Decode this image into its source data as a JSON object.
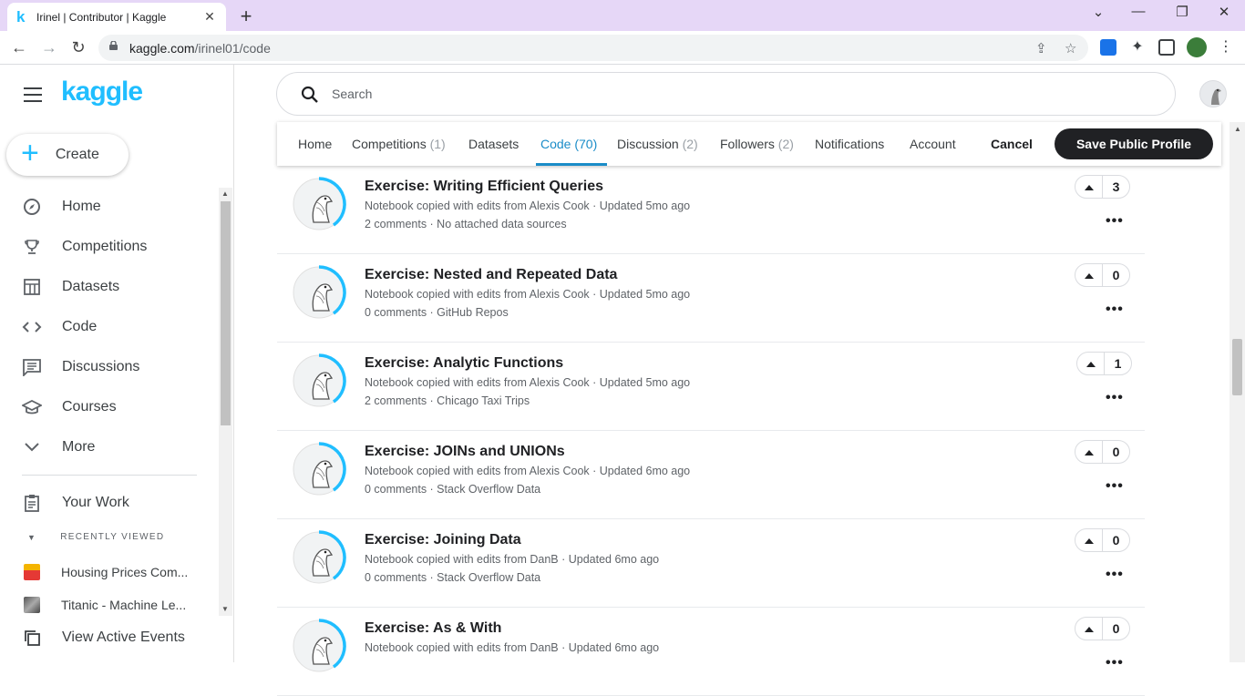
{
  "browser": {
    "tab_title": "Irinel | Contributor | Kaggle",
    "favicon": "k",
    "url_domain": "kaggle.com",
    "url_path": "/irinel01/code"
  },
  "sidebar": {
    "logo": "kaggle",
    "create_label": "Create",
    "items": [
      {
        "label": "Home",
        "icon": "compass-icon"
      },
      {
        "label": "Competitions",
        "icon": "trophy-icon"
      },
      {
        "label": "Datasets",
        "icon": "table-icon"
      },
      {
        "label": "Code",
        "icon": "code-icon"
      },
      {
        "label": "Discussions",
        "icon": "comment-icon"
      },
      {
        "label": "Courses",
        "icon": "school-icon"
      },
      {
        "label": "More",
        "icon": "chevron-down-icon"
      }
    ],
    "your_work": "Your Work",
    "recently_viewed_header": "RECENTLY VIEWED",
    "recent": [
      {
        "label": "Housing Prices Com..."
      },
      {
        "label": "Titanic - Machine Le..."
      }
    ],
    "view_active_events": "View Active Events"
  },
  "search": {
    "placeholder": "Search"
  },
  "profile_tabs": {
    "tabs": [
      {
        "label": "Home",
        "count": ""
      },
      {
        "label": "Competitions",
        "count": "(1)"
      },
      {
        "label": "Datasets",
        "count": ""
      },
      {
        "label": "Code",
        "count": "(70)"
      },
      {
        "label": "Discussion",
        "count": "(2)"
      },
      {
        "label": "Followers",
        "count": "(2)"
      },
      {
        "label": "Notifications",
        "count": ""
      },
      {
        "label": "Account",
        "count": ""
      }
    ],
    "active": "Code",
    "cancel": "Cancel",
    "save": "Save Public Profile"
  },
  "notebooks": [
    {
      "title": "Exercise: Writing Efficient Queries",
      "meta1": "Notebook copied with edits from Alexis Cook · Updated 5mo ago",
      "meta2": "2 comments · No attached data sources",
      "votes": "3"
    },
    {
      "title": "Exercise: Nested and Repeated Data",
      "meta1": "Notebook copied with edits from Alexis Cook · Updated 5mo ago",
      "meta2": "0 comments · GitHub Repos",
      "votes": "0"
    },
    {
      "title": "Exercise: Analytic Functions",
      "meta1": "Notebook copied with edits from Alexis Cook · Updated 5mo ago",
      "meta2": "2 comments · Chicago Taxi Trips",
      "votes": "1"
    },
    {
      "title": "Exercise: JOINs and UNIONs",
      "meta1": "Notebook copied with edits from Alexis Cook · Updated 6mo ago",
      "meta2": "0 comments · Stack Overflow Data",
      "votes": "0"
    },
    {
      "title": "Exercise: Joining Data",
      "meta1": "Notebook copied with edits from DanB · Updated 6mo ago",
      "meta2": "0 comments · Stack Overflow Data",
      "votes": "0"
    },
    {
      "title": "Exercise: As & With",
      "meta1": "Notebook copied with edits from DanB · Updated 6mo ago",
      "meta2": "",
      "votes": "0"
    }
  ],
  "colors": {
    "accent": "#20beff",
    "active_tab": "#1a8cc8",
    "dark_button": "#202124"
  }
}
